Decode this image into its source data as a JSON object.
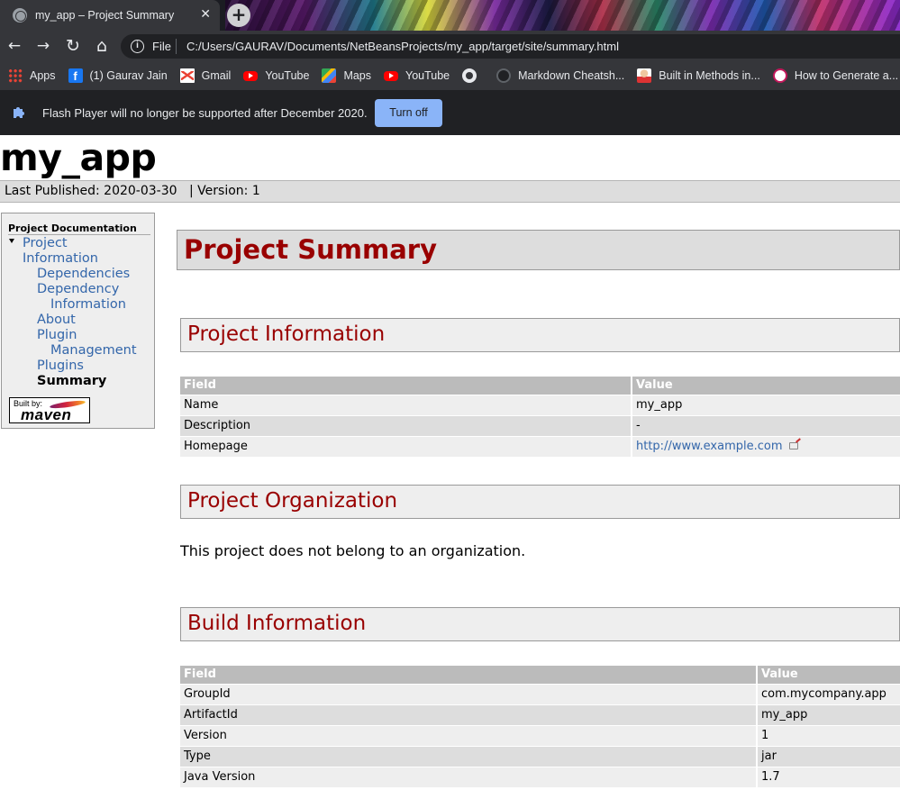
{
  "browser": {
    "tab": {
      "title": "my_app – Project Summary",
      "close_glyph": "✕",
      "new_tab_glyph": "+"
    },
    "nav": {
      "back_glyph": "←",
      "forward_glyph": "→",
      "reload_glyph": "↻",
      "home_glyph": "⌂"
    },
    "address": {
      "scheme": "File",
      "url": "C:/Users/GAURAV/Documents/NetBeansProjects/my_app/target/site/summary.html"
    },
    "bookmarks": [
      {
        "label": "Apps",
        "icon": "apps-grid-icon"
      },
      {
        "label": "(1) Gaurav Jain",
        "icon": "facebook-icon"
      },
      {
        "label": "Gmail",
        "icon": "gmail-icon"
      },
      {
        "label": "YouTube",
        "icon": "youtube-icon"
      },
      {
        "label": "Maps",
        "icon": "maps-icon"
      },
      {
        "label": "YouTube",
        "icon": "youtube-icon"
      },
      {
        "label": "",
        "icon": "globe-icon"
      },
      {
        "label": "Markdown Cheatsh...",
        "icon": "github-icon"
      },
      {
        "label": "Built in Methods in...",
        "icon": "avatar-icon"
      },
      {
        "label": "How to Generate a...",
        "icon": "site-icon"
      }
    ],
    "flash_bar": {
      "message": "Flash Player will no longer be supported after December 2020.",
      "button": "Turn off",
      "icon": "puzzle-icon"
    }
  },
  "site": {
    "title": "my_app",
    "breadcrumbs": {
      "published": "Last Published: 2020-03-30",
      "divider": "|",
      "version": "Version: 1"
    }
  },
  "sidebar": {
    "heading": "Project Documentation",
    "items": {
      "project_information": [
        "Project",
        "Information"
      ],
      "dependencies": "Dependencies",
      "dependency_information": [
        "Dependency",
        "Information"
      ],
      "about": "About",
      "plugin_management": [
        "Plugin",
        "Management"
      ],
      "plugins": "Plugins",
      "summary": "Summary"
    },
    "powered_by": {
      "built_by": "Built by:",
      "logo_text": "maven"
    }
  },
  "main": {
    "title": "Project Summary",
    "project_information": {
      "heading": "Project Information",
      "columns": [
        "Field",
        "Value"
      ],
      "rows": [
        [
          "Name",
          "my_app"
        ],
        [
          "Description",
          "-"
        ],
        [
          "Homepage",
          "http://www.example.com"
        ]
      ]
    },
    "project_organization": {
      "heading": "Project Organization",
      "text": "This project does not belong to an organization."
    },
    "build_information": {
      "heading": "Build Information",
      "columns": [
        "Field",
        "Value"
      ],
      "rows": [
        [
          "GroupId",
          "com.mycompany.app"
        ],
        [
          "ArtifactId",
          "my_app"
        ],
        [
          "Version",
          "1"
        ],
        [
          "Type",
          "jar"
        ],
        [
          "Java Version",
          "1.7"
        ]
      ]
    }
  },
  "colors": {
    "heading_red": "#990000",
    "link_blue": "#3366aa",
    "chrome_dark": "#35363a",
    "turn_off_blue": "#8ab4f8"
  }
}
